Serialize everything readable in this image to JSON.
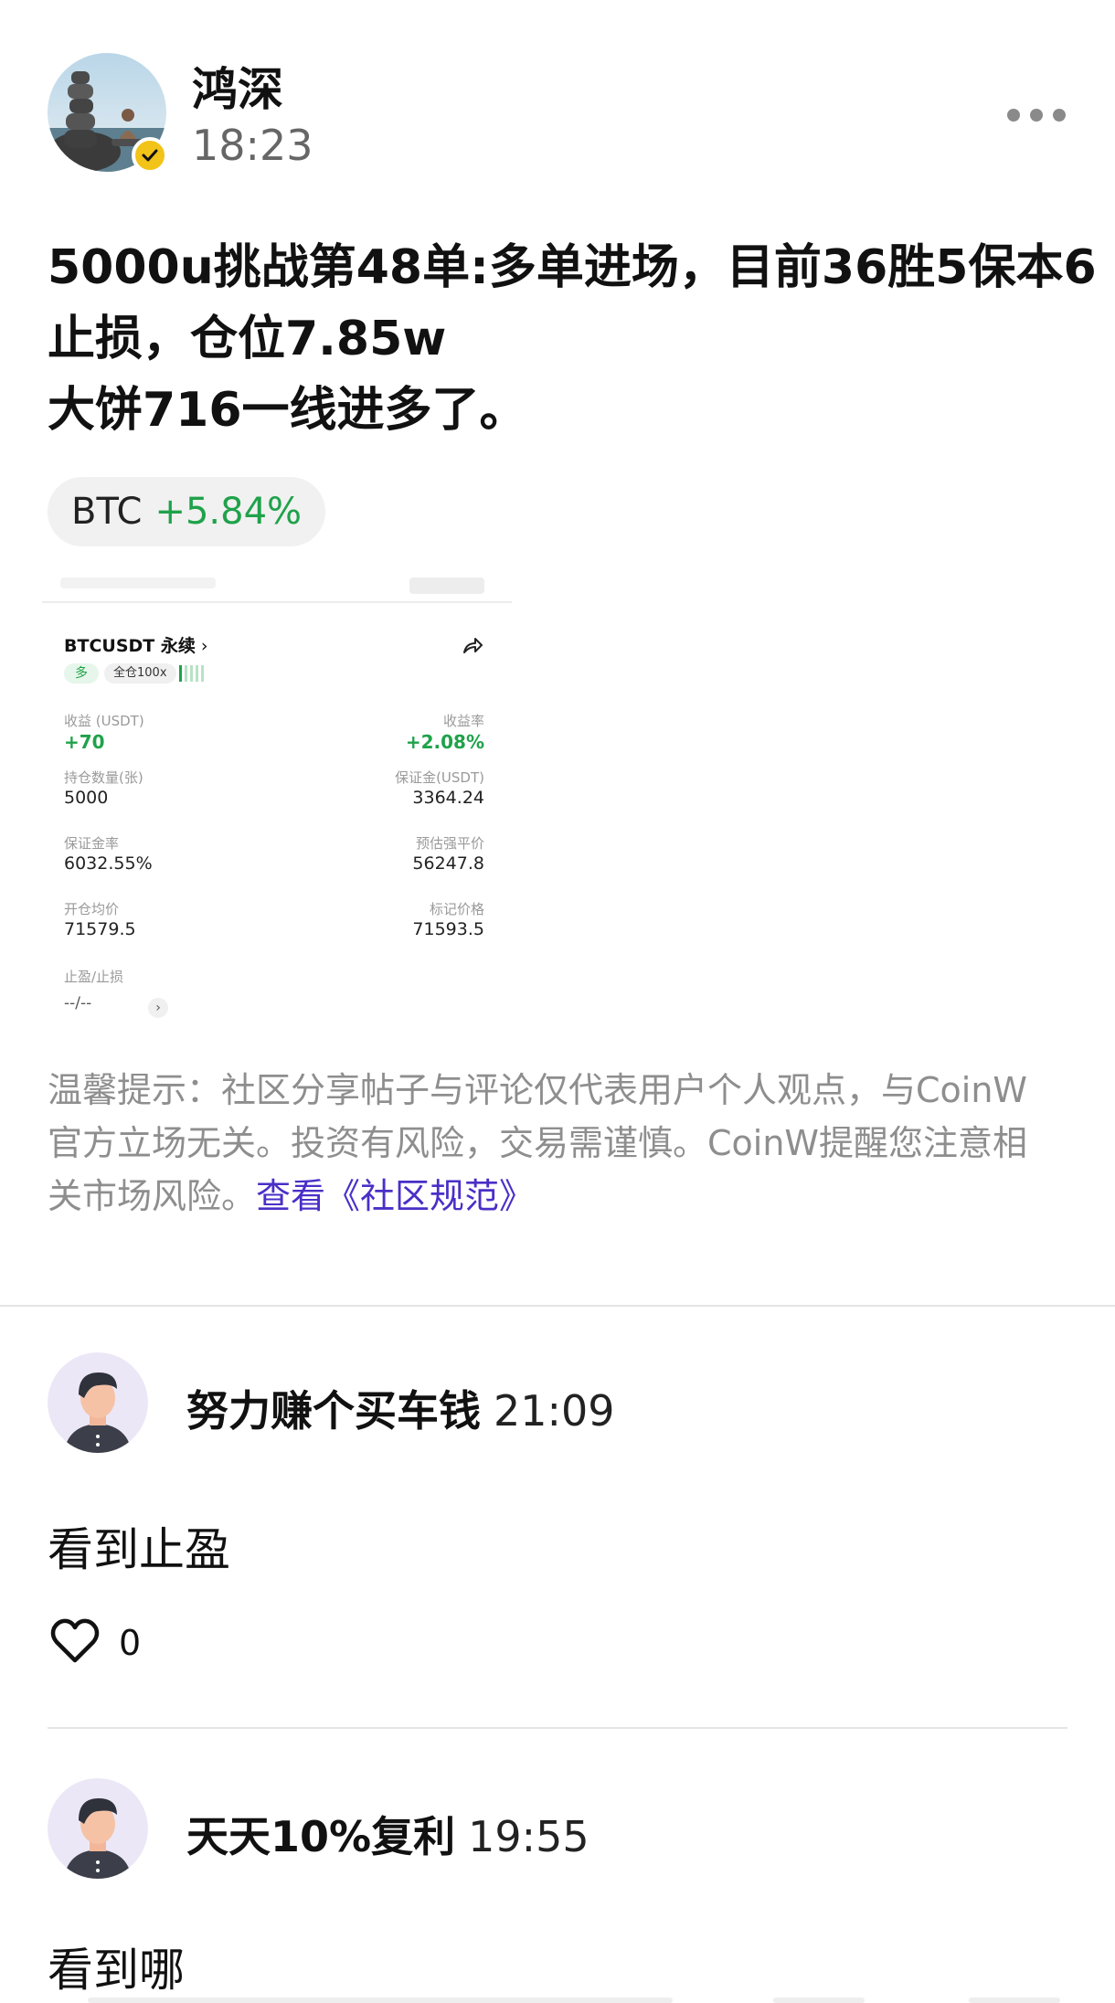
{
  "post": {
    "author": "鸿深",
    "time": "18:23",
    "lines": [
      "5000u挑战第48单:多单进场，目前36胜5保本6",
      "止损，仓位7.85w",
      "大饼716一线进多了。"
    ],
    "ticker": {
      "symbol": "BTC",
      "change": "+5.84%",
      "change_color": "#1fa24a"
    }
  },
  "trade_card": {
    "pair": "BTCUSDT 永续",
    "pair_chevron": "›",
    "side": "多",
    "margin_mode": "全仓100x",
    "fields": {
      "pnl_label": "收益 (USDT)",
      "pnl_value": "+70",
      "roe_label": "收益率",
      "roe_value": "+2.08%",
      "qty_label": "持仓数量(张)",
      "qty_value": "5000",
      "margin_label": "保证金(USDT)",
      "margin_value": "3364.24",
      "margin_rate_label": "保证金率",
      "margin_rate_value": "6032.55%",
      "liq_label": "预估强平价",
      "liq_value": "56247.8",
      "entry_label": "开仓均价",
      "entry_value": "71579.5",
      "mark_label": "标记价格",
      "mark_value": "71593.5",
      "tpsl_label": "止盈/止损",
      "tpsl_value": "--/--"
    }
  },
  "disclaimer": {
    "line1": "温馨提示：社区分享帖子与评论仅代表用户个人观点，与CoinW",
    "line2": "官方立场无关。投资有风险，交易需谨慎。CoinW提醒您注意相",
    "line3": "关市场风险。",
    "link": "查看《社区规范》",
    "link_color": "#4a2fc7"
  },
  "comments": [
    {
      "user": "努力赚个买车钱",
      "time": "21:09",
      "text": "看到止盈",
      "likes": "0"
    },
    {
      "user": "天天10%复利",
      "time": "19:55",
      "text": "看到哪"
    }
  ],
  "icons": {
    "more": "more-dots-icon",
    "verified": "verified-badge-icon",
    "share": "share-icon",
    "like": "heart-icon"
  }
}
